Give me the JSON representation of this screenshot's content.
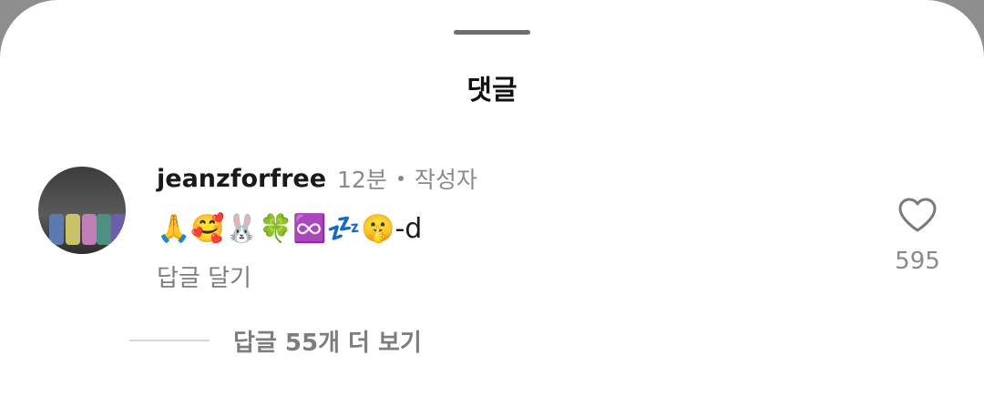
{
  "sheet": {
    "title": "댓글"
  },
  "comment": {
    "username": "jeanzforfree",
    "time": "12분",
    "author_badge": "작성자",
    "text": "🙏🥰🐰🍀♾️💤🤫-d",
    "reply_label": "답글 달기",
    "like_count": "595"
  },
  "replies": {
    "more_label": "답글 55개 더 보기"
  },
  "colors": {
    "text_primary": "#1a1a1a",
    "text_secondary": "#8a8a8a",
    "divider": "#d8d8d8",
    "backdrop": "#8e8e8e"
  }
}
